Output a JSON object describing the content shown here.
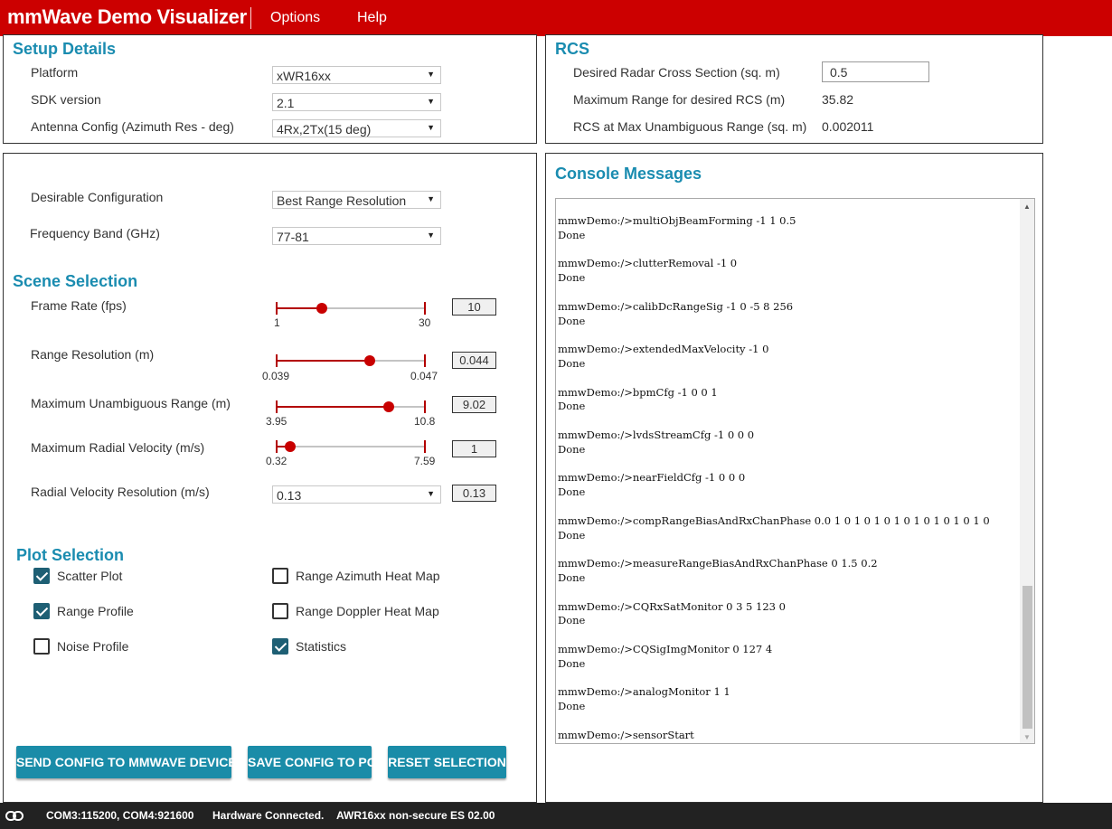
{
  "header": {
    "app_title": "mmWave Demo Visualizer",
    "menu": [
      {
        "label": "Options"
      },
      {
        "label": "Help"
      }
    ],
    "accent_color": "#cc0000"
  },
  "setup": {
    "title": "Setup Details",
    "platform_label": "Platform",
    "platform_value": "xWR16xx",
    "sdk_label": "SDK version",
    "sdk_value": "2.1",
    "antenna_label": "Antenna Config (Azimuth Res - deg)",
    "antenna_value": "4Rx,2Tx(15 deg)"
  },
  "rcs": {
    "title": "RCS",
    "desired_label": "Desired Radar Cross Section (sq. m)",
    "desired_value": "0.5",
    "max_range_label": "Maximum Range for desired RCS (m)",
    "max_range_value": "35.82",
    "rcs_at_max_label": "RCS at Max Unambiguous Range (sq. m)",
    "rcs_at_max_value": "0.002011"
  },
  "config": {
    "desirable_label": "Desirable Configuration",
    "desirable_value": "Best Range Resolution",
    "band_label": "Frequency Band (GHz)",
    "band_value": "77-81"
  },
  "scene": {
    "title": "Scene Selection",
    "sliders": [
      {
        "label": "Frame Rate (fps)",
        "min": "1",
        "max": "30",
        "value": "10",
        "fraction": 0.31
      },
      {
        "label": "Range Resolution (m)",
        "min": "0.039",
        "max": "0.047",
        "value": "0.044",
        "fraction": 0.625
      },
      {
        "label": "Maximum Unambiguous Range (m)",
        "min": "3.95",
        "max": "10.8",
        "value": "9.02",
        "fraction": 0.755
      },
      {
        "label": "Maximum Radial Velocity (m/s)",
        "min": "0.32",
        "max": "7.59",
        "value": "1",
        "fraction": 0.094
      }
    ],
    "vel_res_label": "Radial Velocity Resolution (m/s)",
    "vel_res_select": "0.13",
    "vel_res_value": "0.13"
  },
  "plots": {
    "title": "Plot Selection",
    "items": [
      {
        "label": "Scatter Plot",
        "checked": true
      },
      {
        "label": "Range Azimuth Heat Map",
        "checked": false
      },
      {
        "label": "Range Profile",
        "checked": true
      },
      {
        "label": "Range Doppler Heat Map",
        "checked": false
      },
      {
        "label": "Noise Profile",
        "checked": false
      },
      {
        "label": "Statistics",
        "checked": true
      }
    ]
  },
  "buttons": {
    "send": "SEND CONFIG TO MMWAVE DEVICE",
    "save": "SAVE CONFIG TO PC",
    "reset": "RESET SELECTION"
  },
  "console": {
    "title": "Console Messages",
    "entries": [
      {
        "cmd": "mmwDemo:/>multiObjBeamForming -1 1 0.5",
        "resp": "Done"
      },
      {
        "cmd": "mmwDemo:/>clutterRemoval -1 0",
        "resp": "Done"
      },
      {
        "cmd": "mmwDemo:/>calibDcRangeSig -1 0 -5 8 256",
        "resp": "Done"
      },
      {
        "cmd": "mmwDemo:/>extendedMaxVelocity -1 0",
        "resp": "Done"
      },
      {
        "cmd": "mmwDemo:/>bpmCfg -1 0 0 1",
        "resp": "Done"
      },
      {
        "cmd": "mmwDemo:/>lvdsStreamCfg -1 0 0 0",
        "resp": "Done"
      },
      {
        "cmd": "mmwDemo:/>nearFieldCfg -1 0 0 0",
        "resp": "Done"
      },
      {
        "cmd": "mmwDemo:/>compRangeBiasAndRxChanPhase 0.0 1 0 1 0 1 0 1 0 1 0 1 0 1 0 1 0",
        "resp": "Done"
      },
      {
        "cmd": "mmwDemo:/>measureRangeBiasAndRxChanPhase 0 1.5 0.2",
        "resp": "Done"
      },
      {
        "cmd": "mmwDemo:/>CQRxSatMonitor 0 3 5 123 0",
        "resp": "Done"
      },
      {
        "cmd": "mmwDemo:/>CQSigImgMonitor 0 127 4",
        "resp": "Done"
      },
      {
        "cmd": "mmwDemo:/>analogMonitor 1 1",
        "resp": "Done"
      },
      {
        "cmd": "mmwDemo:/>sensorStart",
        "resp": ""
      }
    ]
  },
  "status": {
    "ports": "COM3:115200, COM4:921600",
    "connection": "Hardware Connected.",
    "device": "AWR16xx non-secure ES 02.00"
  }
}
